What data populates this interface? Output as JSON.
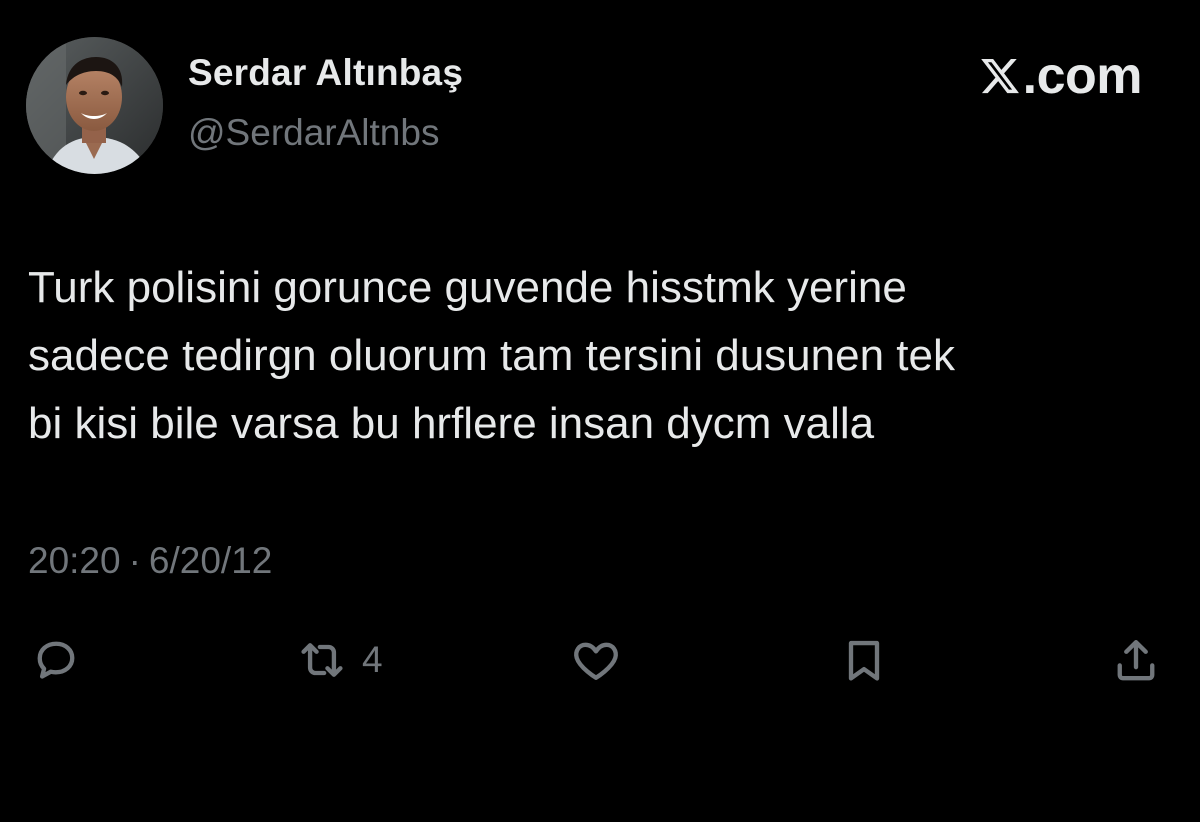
{
  "author": {
    "display_name": "Serdar Altınbaş",
    "handle": "@SerdarAltnbs"
  },
  "brand": {
    "logo_text": ".com",
    "icon": "x-logo-icon"
  },
  "tweet": {
    "lines": [
      "Turk polisini gorunce guvende hisstmk yerine",
      "sadece tedirgn oluorum tam tersini dusunen tek",
      "bi kisi bile varsa bu hrflere insan dycm valla"
    ],
    "time": "20:20",
    "separator": "·",
    "date": "6/20/12"
  },
  "actions": {
    "reply": {
      "icon": "reply-bubble-icon"
    },
    "retweet": {
      "icon": "retweet-icon",
      "count": "4"
    },
    "like": {
      "icon": "heart-icon"
    },
    "bookmark": {
      "icon": "bookmark-icon"
    },
    "share": {
      "icon": "share-upload-icon"
    }
  },
  "colors": {
    "background": "#000000",
    "primary_text": "#e7e9ea",
    "secondary_text": "#71767b"
  }
}
